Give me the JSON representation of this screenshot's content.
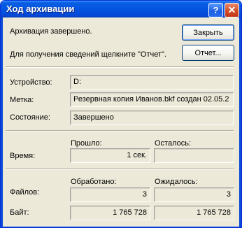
{
  "window": {
    "title": "Ход архивации",
    "help_glyph": "?",
    "close_glyph": "✕"
  },
  "status_message": "Архивация завершено.",
  "report_hint": "Для получения сведений щелкните \"Отчет\".",
  "buttons": {
    "close_label": "Закрыть",
    "report_label": "Отчет..."
  },
  "details": {
    "device_label": "Устройство:",
    "device_value": "D:",
    "tag_label": "Метка:",
    "tag_value": "Резервная копия Иванов.bkf создан 02.05.2",
    "state_label": "Состояние:",
    "state_value": "Завершено"
  },
  "time": {
    "row_label": "Время:",
    "elapsed_header": "Прошло:",
    "remaining_header": "Осталось:",
    "elapsed_value": "1 сек.",
    "remaining_value": ""
  },
  "counts": {
    "processed_header": "Обработано:",
    "expected_header": "Ожидалось:",
    "files_label": "Файлов:",
    "files_processed": "3",
    "files_expected": "3",
    "bytes_label": "Байт:",
    "bytes_processed": "1 765 728",
    "bytes_expected": "1 765 728"
  }
}
